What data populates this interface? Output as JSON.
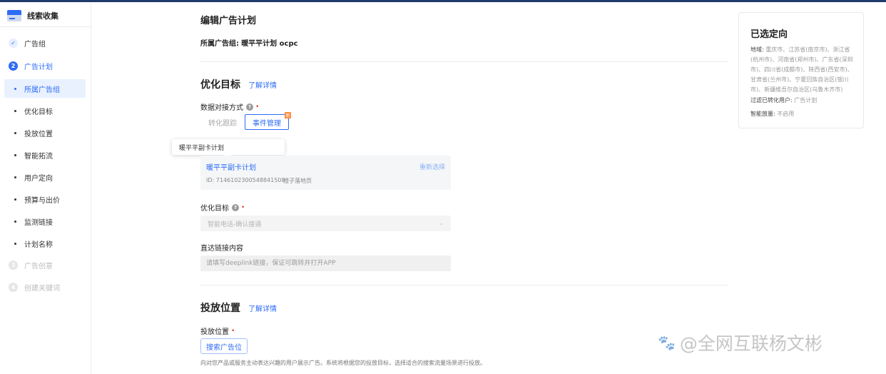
{
  "app": {
    "title": "线索收集"
  },
  "sidebar": {
    "steps": [
      {
        "num": "✓",
        "label": "广告组",
        "state": "done"
      },
      {
        "num": "2",
        "label": "广告计划",
        "state": "active"
      },
      {
        "num": "3",
        "label": "广告创意",
        "state": "disabled"
      },
      {
        "num": "4",
        "label": "创建关键词",
        "state": "disabled"
      }
    ],
    "sub_items": [
      "所属广告组",
      "优化目标",
      "投放位置",
      "智能拓流",
      "用户定向",
      "预算与出价",
      "监测链接",
      "计划名称"
    ]
  },
  "main": {
    "title": "编辑广告计划",
    "group_label": "所属广告组:",
    "group_value": "暖平平计划 ocpc",
    "opt_section": {
      "title": "优化目标",
      "learn_more": "了解详情",
      "data_mode_label": "数据对接方式",
      "seg_options": [
        "转化跟踪",
        "事件管理"
      ],
      "seg_new_badge": "新",
      "tooltip": "暖平平副卡计划",
      "asset": {
        "name": "暖平平副卡计划",
        "reselect": "重新选择",
        "id": "ID: 7146102300548841508",
        "type": "橙子落地页"
      },
      "goal_label": "优化目标",
      "goal_value": "智能电话-确认接通",
      "deeplink_label": "直达链接内容",
      "deeplink_placeholder": "请填写deeplink链接，保证可跳转并打开APP"
    },
    "placement_section": {
      "title": "投放位置",
      "learn_more": "了解详情",
      "label": "投放位置",
      "button": "搜索广告位",
      "desc": "向对您产品或服务主动表达兴趣的用户展示广告。系统将根据您的投放目标，选择适合的搜索流量场景进行投放。"
    }
  },
  "targeting": {
    "title": "已选定向",
    "region_key": "地域:",
    "region_value": "重庆市、江苏省(南京市)、浙江省(杭州市)、河南省(郑州市)、广东省(深圳市)、四川省(成都市)、陕西省(西安市)、甘肃省(兰州市)、宁夏回族自治区(银川市)、新疆维吾尔自治区(乌鲁木齐市)",
    "filter_key": "过滤已转化用户:",
    "filter_value": "广告计划",
    "smart_key": "智能放量:",
    "smart_value": "不启用"
  },
  "watermark": {
    "icon": "🐾",
    "text": "@全网互联杨文彬"
  },
  "colors": {
    "accent": "#2d6cf6",
    "required": "#e23c3c",
    "topbar": "#1f3a6b"
  }
}
